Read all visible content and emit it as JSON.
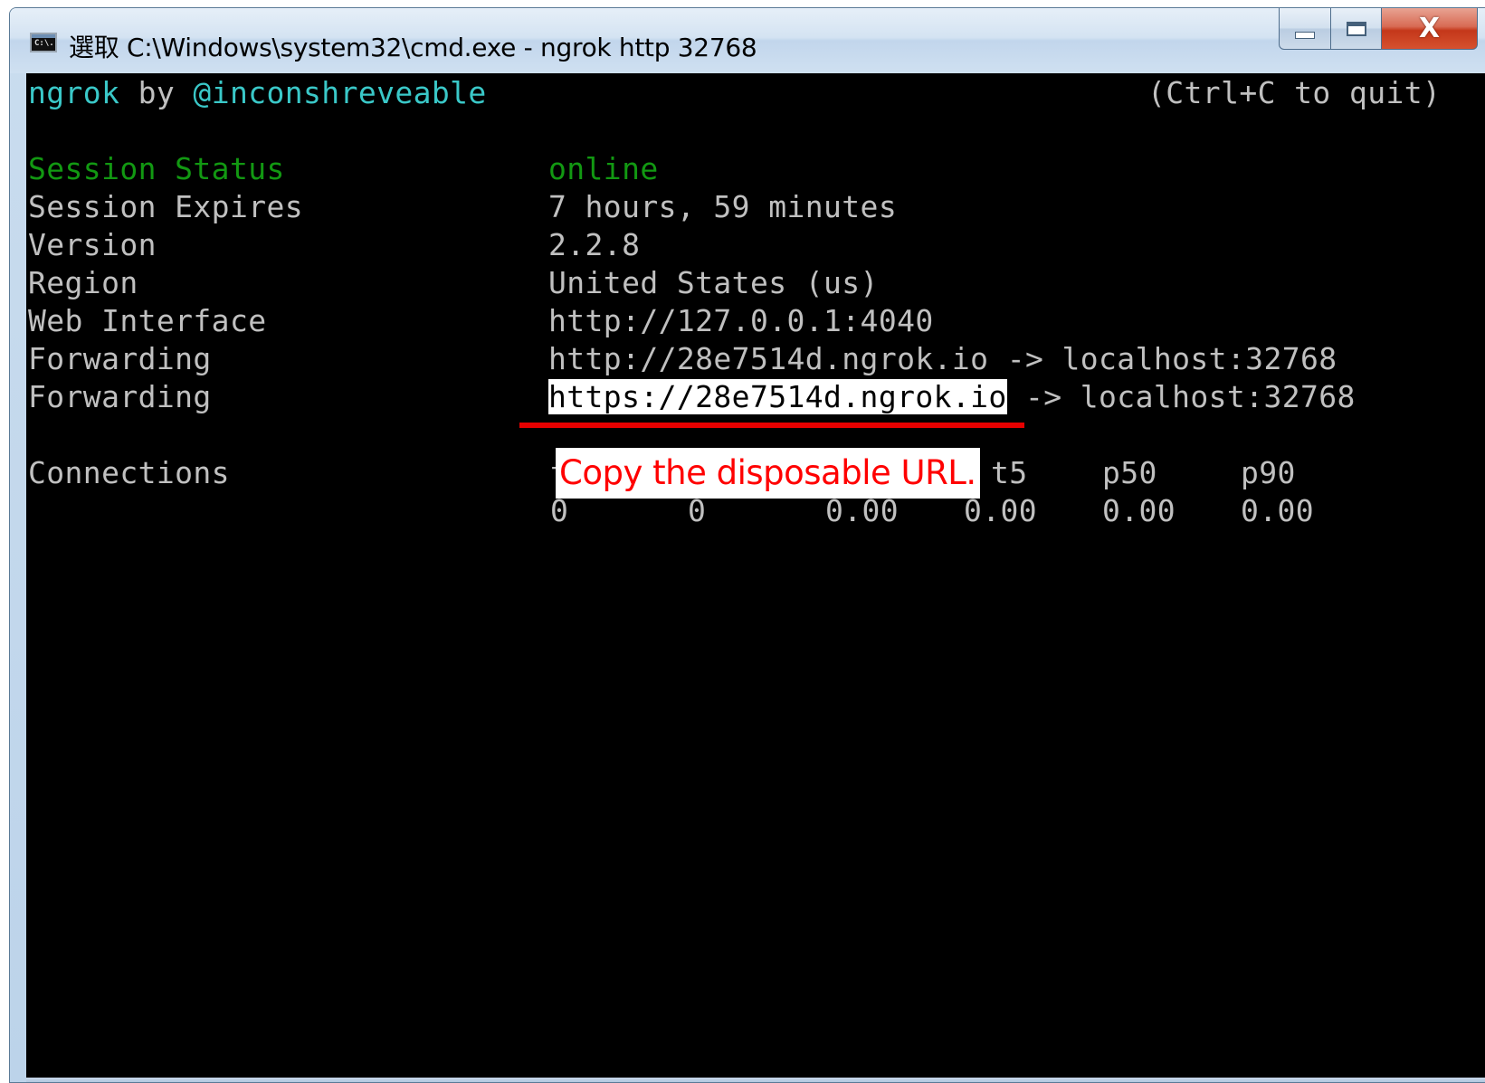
{
  "window": {
    "title": "選取 C:\\Windows\\system32\\cmd.exe - ngrok  http 32768",
    "icon_text": "C:\\.",
    "icons": {
      "app": "console-icon",
      "minimize": "minimize-icon",
      "maximize": "maximize-icon",
      "close": "close-icon"
    },
    "close_label": "X"
  },
  "console": {
    "brand": "ngrok",
    "by": " by ",
    "author": "@inconshreveable",
    "quit_hint": "(Ctrl+C to quit)",
    "rows": [
      {
        "label": "Session Status",
        "value": "online"
      },
      {
        "label": "Session Expires",
        "value": "7 hours, 59 minutes"
      },
      {
        "label": "Version",
        "value": "2.2.8"
      },
      {
        "label": "Region",
        "value": "United States (us)"
      },
      {
        "label": "Web Interface",
        "value": "http://127.0.0.1:4040"
      },
      {
        "label": "Forwarding",
        "value": "http://28e7514d.ngrok.io -> localhost:32768"
      },
      {
        "label": "Forwarding",
        "selected_value": "https://28e7514d.ngrok.io",
        "value_rest": " -> localhost:32768"
      }
    ],
    "connections": {
      "label": "Connections",
      "headers_partial_left": "t",
      "headers_partial_right": "t5",
      "header_p50": "p50",
      "header_p90": "p90",
      "values": [
        "0",
        "0",
        "0.00",
        "0.00",
        "0.00",
        "0.00"
      ]
    }
  },
  "annotation": {
    "text": "Copy the disposable URL.",
    "color": "#ff0000"
  },
  "colors": {
    "console_bg": "#000000",
    "console_text": "#c0c0c0",
    "cyan": "#3ac8c8",
    "green": "#129812",
    "selection_bg": "#ffffff",
    "underline": "#e60000"
  }
}
